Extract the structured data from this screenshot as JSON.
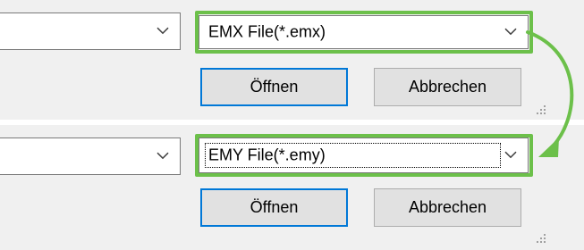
{
  "top": {
    "filter_value": "EMX File(*.emx)",
    "open_button": "Öffnen",
    "cancel_button": "Abbrechen"
  },
  "bottom": {
    "filter_value": "EMY File(*.emy)",
    "open_button": "Öffnen",
    "cancel_button": "Abbrechen"
  },
  "icons": {
    "dropdown": "chevron-down-icon",
    "annotation": "curved-arrow-icon",
    "resize": "resize-grip-icon"
  },
  "colors": {
    "highlight": "#6cc04a",
    "default_button_border": "#0078d7",
    "dialog_background": "#f0f0f0"
  }
}
